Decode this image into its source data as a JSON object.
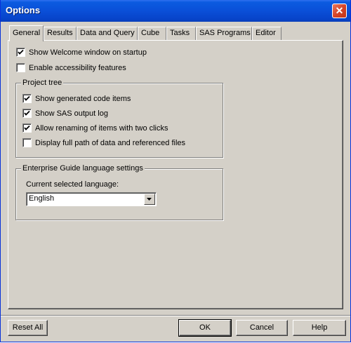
{
  "window": {
    "title": "Options"
  },
  "tabs": [
    {
      "label": "General",
      "active": true
    },
    {
      "label": "Results"
    },
    {
      "label": "Data and Query"
    },
    {
      "label": "Cube"
    },
    {
      "label": "Tasks"
    },
    {
      "label": "SAS Programs"
    },
    {
      "label": "Editor"
    }
  ],
  "general": {
    "show_welcome": {
      "label": "Show Welcome window on startup",
      "checked": true
    },
    "accessibility": {
      "label": "Enable accessibility features",
      "checked": false
    }
  },
  "project_tree": {
    "legend": "Project tree",
    "items": [
      {
        "label": "Show generated code items",
        "checked": true
      },
      {
        "label": "Show SAS output log",
        "checked": true
      },
      {
        "label": "Allow renaming of items with two clicks",
        "checked": true
      },
      {
        "label": "Display full path of data and referenced files",
        "checked": false
      }
    ]
  },
  "language": {
    "legend": "Enterprise Guide language settings",
    "label": "Current selected language:",
    "value": "English"
  },
  "buttons": {
    "reset_all": "Reset All",
    "ok": "OK",
    "cancel": "Cancel",
    "help": "Help"
  },
  "colors": {
    "titlebar": "#0a4fd8",
    "dialog_face": "#d4d0c8",
    "close_button": "#d5462a"
  }
}
